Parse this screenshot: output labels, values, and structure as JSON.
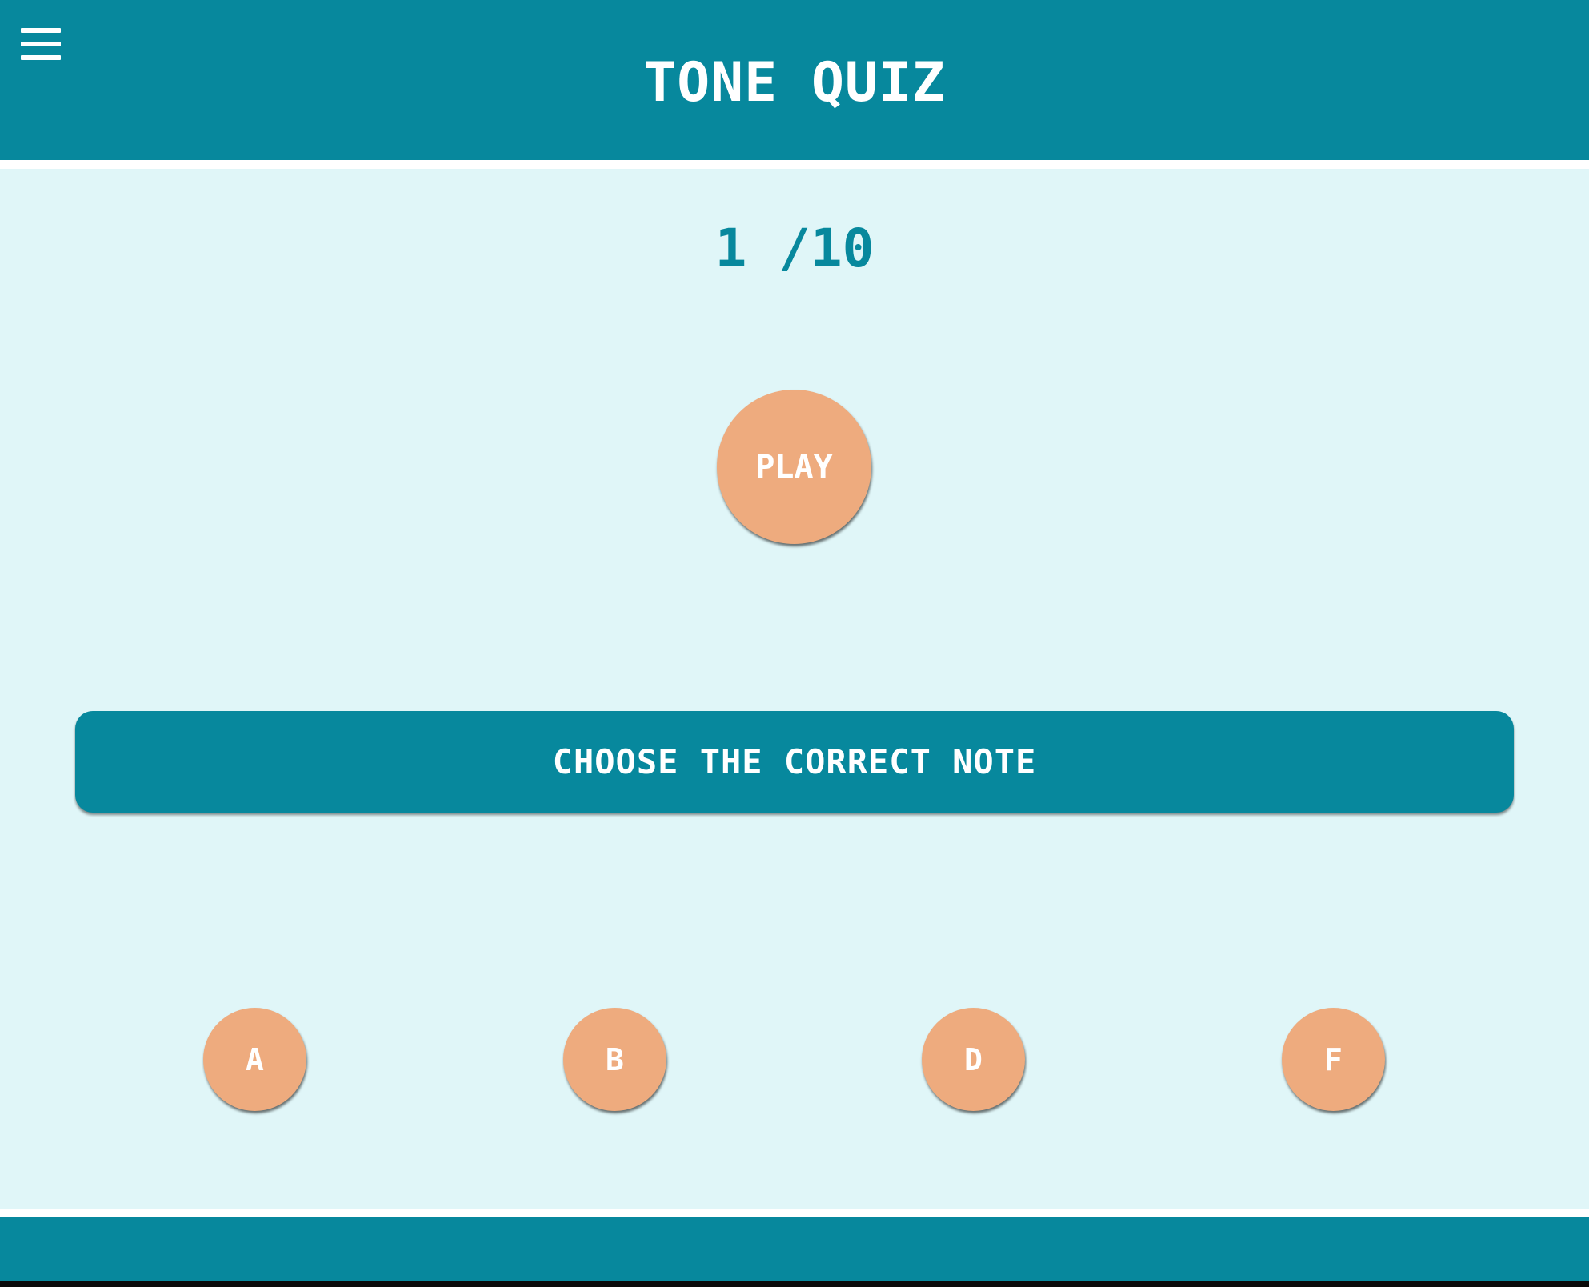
{
  "header": {
    "title": "TONE QUIZ",
    "menu_icon": "hamburger-menu-icon"
  },
  "quiz": {
    "progress": "1 /10",
    "play_label": "PLAY",
    "prompt": "CHOOSE THE CORRECT NOTE",
    "options": [
      "A",
      "B",
      "D",
      "F"
    ]
  },
  "colors": {
    "primary": "#07889d",
    "background": "#e0f6f8",
    "accent": "#eeab7e",
    "text_on_primary": "#ffffff"
  }
}
